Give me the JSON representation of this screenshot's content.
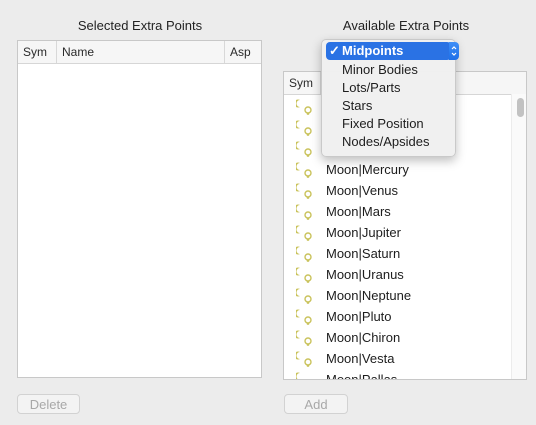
{
  "left_panel": {
    "title": "Selected Extra Points",
    "columns": [
      "Sym",
      "Name",
      "Asp"
    ],
    "delete_label": "Delete"
  },
  "right_panel": {
    "title": "Available Extra Points",
    "column_sym": "Sym",
    "add_label": "Add",
    "dropdown": {
      "selected": "Midpoints",
      "options": [
        "Midpoints",
        "Minor Bodies",
        "Lots/Parts",
        "Stars",
        "Fixed Position",
        "Nodes/Apsides"
      ],
      "check": "✓"
    },
    "rows": [
      {
        "name": "",
        "icon": "moon-sun-midpoint-icon"
      },
      {
        "name": "",
        "icon": "moon-sun-midpoint-icon"
      },
      {
        "name": "",
        "icon": "moon-node-midpoint-icon"
      },
      {
        "name": "Moon|Mercury",
        "icon": "moon-mercury-icon"
      },
      {
        "name": "Moon|Venus",
        "icon": "moon-venus-icon"
      },
      {
        "name": "Moon|Mars",
        "icon": "moon-mars-icon"
      },
      {
        "name": "Moon|Jupiter",
        "icon": "moon-jupiter-icon"
      },
      {
        "name": "Moon|Saturn",
        "icon": "moon-saturn-icon"
      },
      {
        "name": "Moon|Uranus",
        "icon": "moon-uranus-icon"
      },
      {
        "name": "Moon|Neptune",
        "icon": "moon-neptune-icon"
      },
      {
        "name": "Moon|Pluto",
        "icon": "moon-pluto-icon"
      },
      {
        "name": "Moon|Chiron",
        "icon": "moon-chiron-icon"
      },
      {
        "name": "Moon|Vesta",
        "icon": "moon-vesta-icon"
      },
      {
        "name": "Moon|Pallas",
        "icon": "moon-pallas-icon"
      }
    ]
  },
  "colors": {
    "accent": "#2a72e4",
    "symbol": "#c9c25a"
  }
}
